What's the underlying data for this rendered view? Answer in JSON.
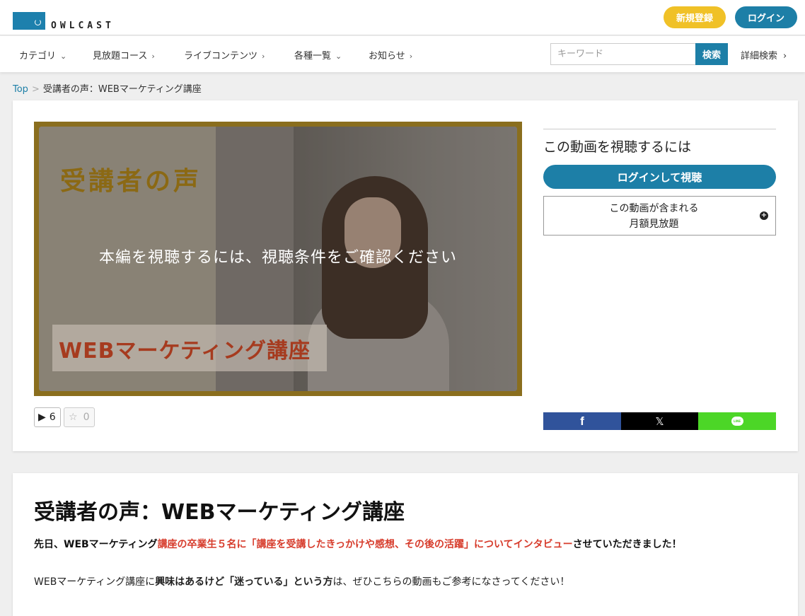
{
  "header": {
    "logo_text": "OWLCAST",
    "signup_label": "新規登録",
    "login_label": "ログイン"
  },
  "nav": {
    "items": [
      {
        "label": "カテゴリ",
        "chevron": "⌄"
      },
      {
        "label": "見放題コース",
        "chevron": "›"
      },
      {
        "label": "ライブコンテンツ",
        "chevron": "›"
      },
      {
        "label": "各種一覧",
        "chevron": "⌄"
      },
      {
        "label": "お知らせ",
        "chevron": "›"
      }
    ],
    "search_placeholder": "キーワード",
    "search_button": "検索",
    "advanced_search": "詳細検索",
    "advanced_chevron": "›"
  },
  "breadcrumb": {
    "top": "Top",
    "separator": ">",
    "current": "受講者の声：WEBマーケティング講座"
  },
  "video": {
    "title_overlay": "受講者の声",
    "subtitle_overlay": "WEBマーケティング講座",
    "message": "本編を視聴するには、視聴条件をご確認ください",
    "play_count": "6",
    "favorite_count": "0"
  },
  "sidebar": {
    "heading": "この動画を視聴するには",
    "watch_button": "ログインして視聴",
    "plan_line1": "この動画が含まれる",
    "plan_line2": "月額見放題",
    "plan_expand": "+"
  },
  "share": {
    "facebook": "f",
    "x": "𝕏",
    "line": "LINE"
  },
  "article": {
    "title": "受講者の声：WEBマーケティング講座",
    "lead_before": "先日、WEBマーケティング",
    "lead_highlight": "講座の卒業生５名に「講座を受講したきっかけや感想、その後の活躍」についてインタビュー",
    "lead_after": "させていただきました！",
    "body_1": "WEBマーケティング講座に",
    "body_bold": "興味はあるけど「迷っている」という方",
    "body_2": "は、ぜひこちらの動画もご参考になさってください！"
  },
  "colors": {
    "primary": "#1d7fa7",
    "signup": "#f0c127",
    "highlight_red": "#d73c2c",
    "facebook": "#30539b",
    "line": "#4cd627"
  }
}
